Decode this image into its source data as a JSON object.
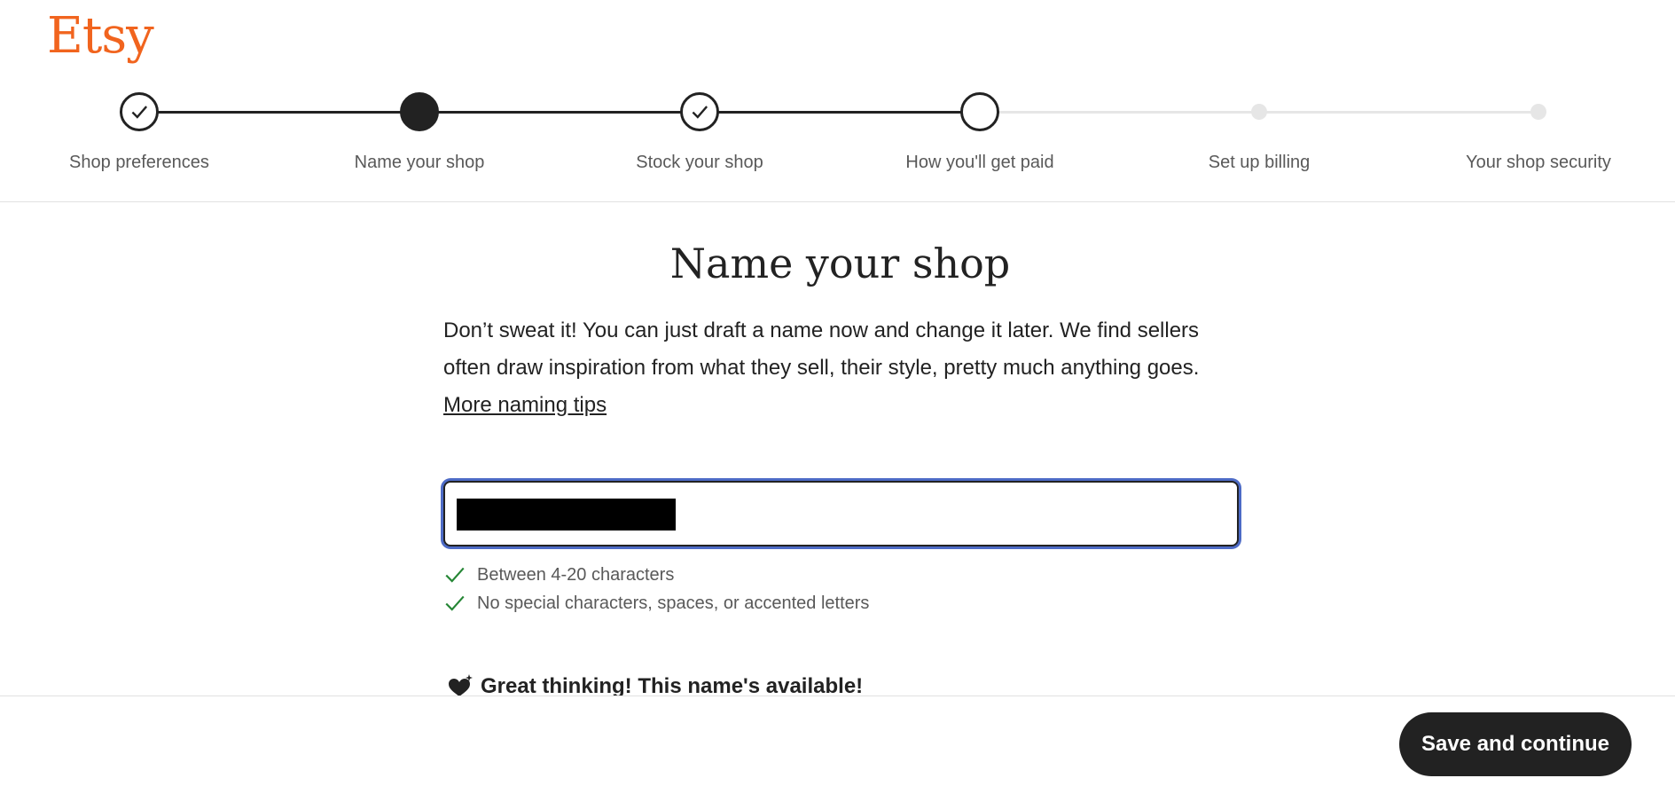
{
  "brand": {
    "logo_text": "Etsy",
    "color": "#f1641e"
  },
  "stepper": {
    "steps": [
      {
        "label": "Shop preferences",
        "state": "complete"
      },
      {
        "label": "Name your shop",
        "state": "current"
      },
      {
        "label": "Stock your shop",
        "state": "complete"
      },
      {
        "label": "How you'll get paid",
        "state": "incomplete"
      },
      {
        "label": "Set up billing",
        "state": "upcoming"
      },
      {
        "label": "Your shop security",
        "state": "upcoming"
      }
    ]
  },
  "main": {
    "title": "Name your shop",
    "intro": "Don’t sweat it! You can just draft a name now and change it later. We find sellers often draw inspiration from what they sell, their style, pretty much anything goes.",
    "tips_link": "More naming tips",
    "shop_name_input": {
      "value": "",
      "redacted": true
    },
    "rules": [
      {
        "text": "Between 4-20 characters",
        "met": true
      },
      {
        "text": "No special characters, spaces, or accented letters",
        "met": true
      }
    ],
    "availability_message": "Great thinking! This name's available!"
  },
  "footer": {
    "save_label": "Save and continue"
  },
  "colors": {
    "accent": "#f1641e",
    "primary_dark": "#222222",
    "check_green": "#258635",
    "focus_ring": "#4d6bc6"
  }
}
